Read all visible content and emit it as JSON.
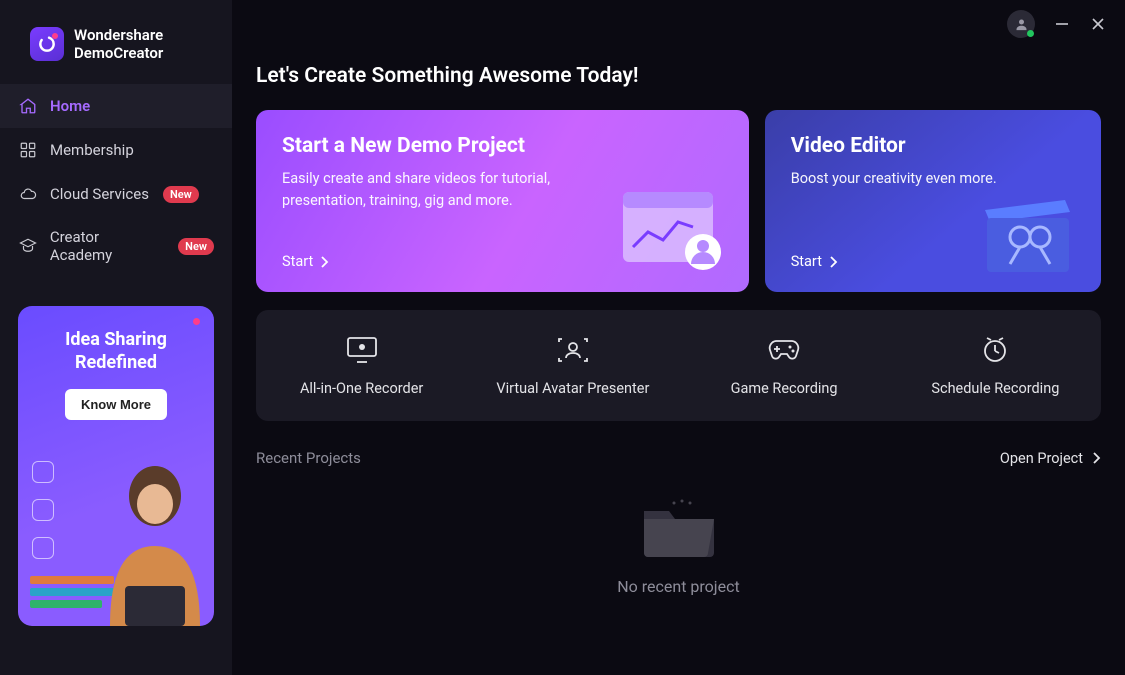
{
  "app": {
    "brand1": "Wondershare",
    "brand2": "DemoCreator"
  },
  "nav": {
    "items": [
      {
        "label": "Home",
        "active": true,
        "badge": null
      },
      {
        "label": "Membership",
        "active": false,
        "badge": null
      },
      {
        "label": "Cloud Services",
        "active": false,
        "badge": "New"
      },
      {
        "label": "Creator Academy",
        "active": false,
        "badge": "New"
      }
    ]
  },
  "promo": {
    "line1": "Idea Sharing",
    "line2": "Redefined",
    "button": "Know More"
  },
  "hero": "Let's Create Something Awesome Today!",
  "cards": {
    "demo": {
      "title": "Start a New Demo Project",
      "desc": "Easily create and share videos for tutorial, presentation, training, gig and more.",
      "cta": "Start"
    },
    "editor": {
      "title": "Video Editor",
      "desc": "Boost your creativity even more.",
      "cta": "Start"
    }
  },
  "tools": [
    {
      "label": "All-in-One Recorder"
    },
    {
      "label": "Virtual Avatar Presenter"
    },
    {
      "label": "Game Recording"
    },
    {
      "label": "Schedule Recording"
    }
  ],
  "recent": {
    "title": "Recent Projects",
    "open": "Open Project",
    "empty": "No recent project"
  }
}
